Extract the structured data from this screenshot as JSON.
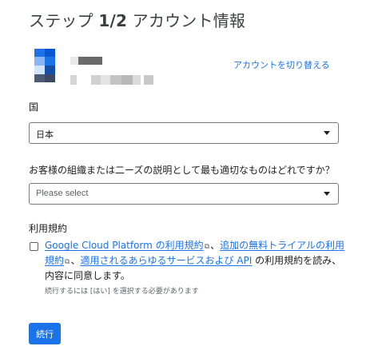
{
  "header": {
    "step_prefix": "ステップ ",
    "step_number": "1/2",
    "step_title": " アカウント情報"
  },
  "account": {
    "avatar_icon": "account-avatar-icon",
    "switch_link": "アカウントを切り替える",
    "colors": [
      "#1a73e8",
      "#0b57d0",
      "#8ab4f8",
      "#174ea6",
      "#5f6368"
    ]
  },
  "country": {
    "label": "国",
    "value": "日本"
  },
  "needs": {
    "question": "お客様の組織または二ーズの説明として最も適切なものはどれですか？",
    "placeholder": "Please select"
  },
  "terms": {
    "heading": "利用規約",
    "link_gcp": "Google Cloud Platform の利用規約",
    "sep1": "、",
    "link_trial": "追加の無料トライアルの利用規約",
    "sep2": "、",
    "link_services": "適用されるあらゆるサービスおよび API",
    "suffix": " の利用規約を読み、内容に同意します。",
    "hint": "続行するには [はい] を選択する必要があります"
  },
  "actions": {
    "continue_label": "続行"
  },
  "colors": {
    "accent": "#1a73e8",
    "text": "#202124",
    "muted": "#5f6368"
  }
}
